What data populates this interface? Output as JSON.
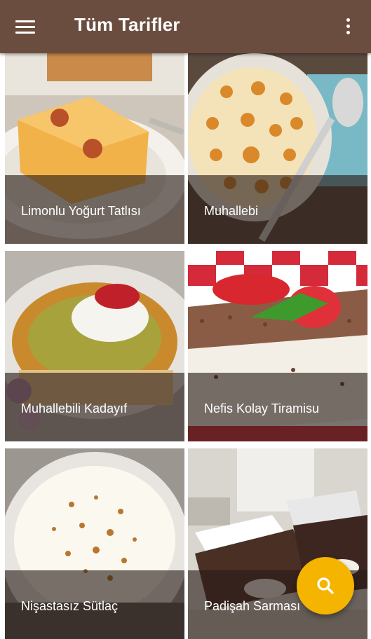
{
  "app": {
    "title": "Tüm Tarifler",
    "menu_icon": "hamburger-menu-icon",
    "more_icon": "more-vertical-icon"
  },
  "colors": {
    "appbar": "#6b4d3f",
    "fab": "#f4b400",
    "caption_overlay": "rgba(40,28,22,0.62)"
  },
  "recipes": [
    {
      "name": "Limonlu Yoğurt Tatlısı"
    },
    {
      "name": "Muhallebi"
    },
    {
      "name": "Muhallebili Kadayıf"
    },
    {
      "name": "Nefis Kolay Tiramisu"
    },
    {
      "name": "Nişastasız Sütlaç"
    },
    {
      "name": "Padişah Sarması"
    }
  ],
  "fab": {
    "icon": "search-icon"
  }
}
